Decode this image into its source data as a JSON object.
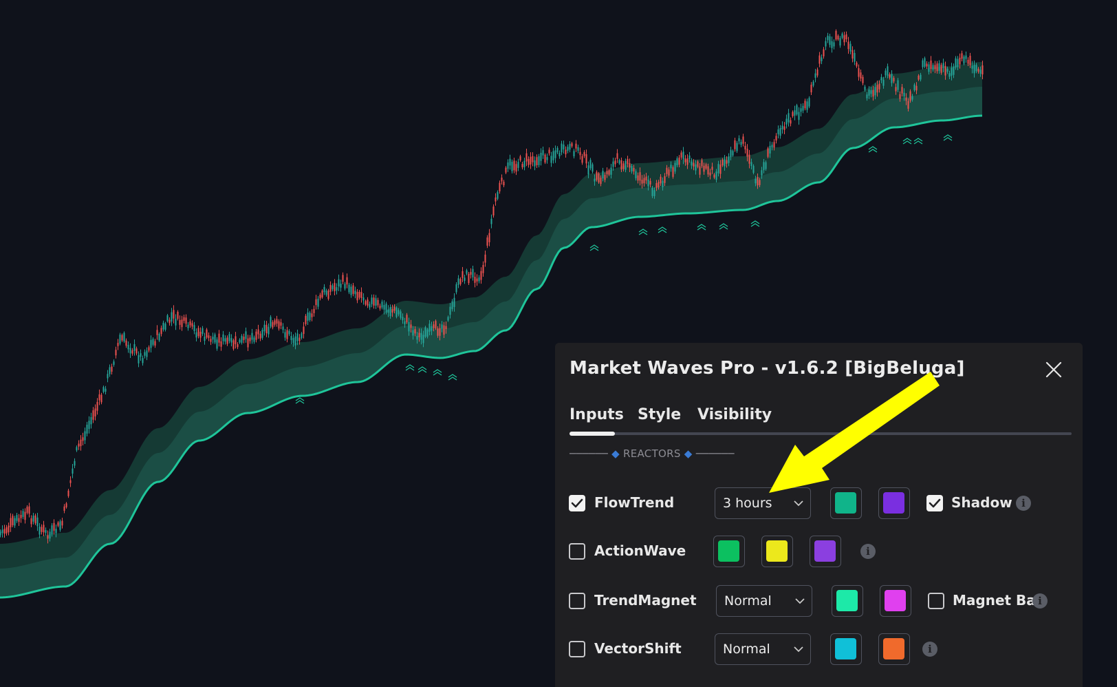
{
  "dialog": {
    "title": "Market Waves Pro - v1.6.2 [BigBeluga]",
    "tabs": [
      {
        "label": "Inputs",
        "active": true
      },
      {
        "label": "Style",
        "active": false
      },
      {
        "label": "Visibility",
        "active": false
      }
    ],
    "section": {
      "dashes": "──────",
      "label": "REACTORS"
    },
    "rows": [
      {
        "label": "FlowTrend",
        "checked": true,
        "select": "3 hours",
        "colors": [
          "#10b48a",
          "#7a2fe0"
        ],
        "extra": {
          "label": "Shadow",
          "checked": true
        }
      },
      {
        "label": "ActionWave",
        "checked": false,
        "colors": [
          "#0cc060",
          "#ece81c",
          "#8b3fe0"
        ]
      },
      {
        "label": "TrendMagnet",
        "checked": false,
        "select": "Normal",
        "colors": [
          "#1de9a8",
          "#e040ef"
        ],
        "extra": {
          "label": "Magnet Bar",
          "checked": false
        }
      },
      {
        "label": "VectorShift",
        "checked": false,
        "select": "Normal",
        "colors": [
          "#10c0d8",
          "#f06a2c"
        ]
      }
    ]
  },
  "icons": {
    "close": "close-icon",
    "check": "check-icon",
    "chevron": "chevron-down-icon",
    "info": "info-icon",
    "info_glyph": "i",
    "annotation": "arrow-annotation-icon",
    "signal": "double-chevron-up-icon"
  },
  "colors": {
    "background": "#0f121b",
    "band_outer": "#153a34",
    "band_inner": "#1b4e45",
    "band_line": "#1fc59a",
    "candle_up": "#26a69a",
    "candle_down": "#ef5350",
    "arrow": "#ffff00"
  }
}
